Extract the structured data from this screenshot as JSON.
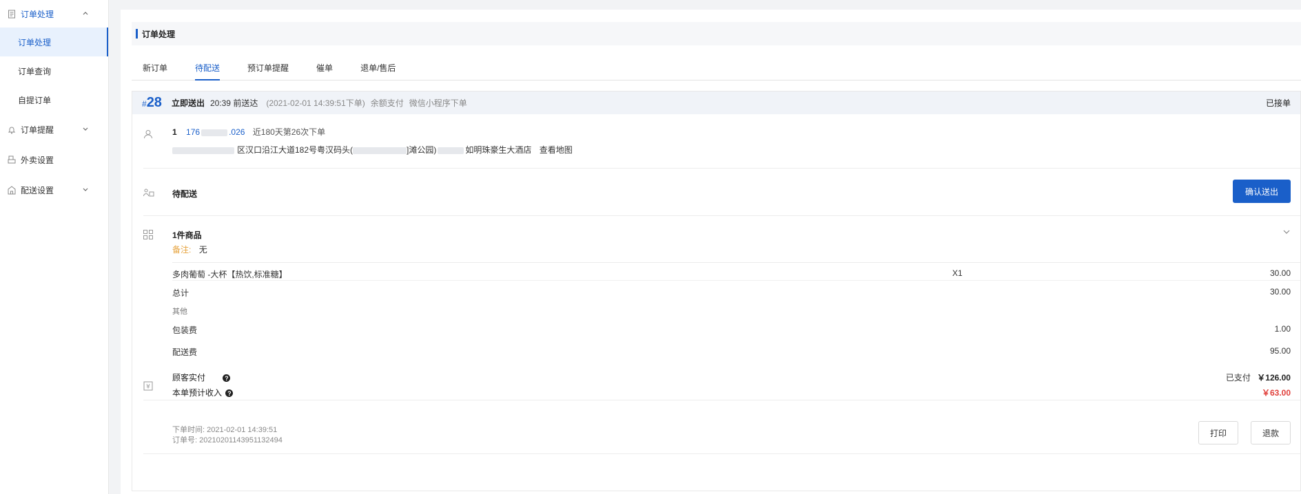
{
  "sidebar": {
    "groups": [
      {
        "label": "订单处理",
        "icon": "document-icon",
        "chevron": "chevron-up-icon"
      },
      {
        "label": "订单提醒",
        "icon": "bell-icon",
        "chevron": "chevron-down-icon"
      },
      {
        "label": "外卖设置",
        "icon": "printer-icon"
      },
      {
        "label": "配送设置",
        "icon": "store-icon",
        "chevron": "chevron-down-icon"
      }
    ],
    "subitems": [
      "订单处理",
      "订单查询",
      "自提订单"
    ]
  },
  "header": {
    "title": "订单处理"
  },
  "tabs": [
    "新订单",
    "待配送",
    "预订单提醒",
    "催单",
    "退单/售后"
  ],
  "order": {
    "hash": "#",
    "number": "28",
    "ship_type": "立即送出",
    "deliver_time": "20:39 前送达",
    "placed": "(2021-02-01 14:39:51下单)",
    "payment": "余额支付",
    "channel": "微信小程序下单",
    "status": "已接单",
    "customer": {
      "name": "1",
      "phone_start": "176",
      "phone_end": ".026",
      "history": "近180天第26次下单",
      "address_part1": "区汉口沿江大道182号粤汉码头(",
      "address_part2": "]滩公园)",
      "address_part3": "如明珠豪生大酒店",
      "map_link": "查看地图"
    },
    "delivery": {
      "status": "待配送",
      "confirm_button": "确认送出"
    },
    "items": {
      "count_label": "1件商品",
      "remark_label": "备注:",
      "remark_value": "无",
      "product_name": "多肉葡萄 -大杯【热饮,标准糖】",
      "product_qty": "X1",
      "product_price": "30.00",
      "subtotal_label": "总计",
      "subtotal": "30.00",
      "other_label": "其他",
      "packing_label": "包装费",
      "packing": "1.00",
      "delivery_fee_label": "配送费",
      "delivery_fee": "95.00"
    },
    "payment_summary": {
      "paid_label": "顾客实付",
      "paid_status": "已支付",
      "paid_amount": "￥126.00",
      "income_label": "本单预计收入",
      "income_amount": "￥63.00"
    },
    "footer": {
      "time": "下单时间: 2021-02-01 14:39:51",
      "order_no": "订单号: 20210201143951132494",
      "print_button": "打印",
      "refund_button": "退款"
    }
  },
  "colors": {
    "accent": "#1a5fc9",
    "price_red": "#e0403b",
    "remark_orange": "#e6a23c"
  }
}
